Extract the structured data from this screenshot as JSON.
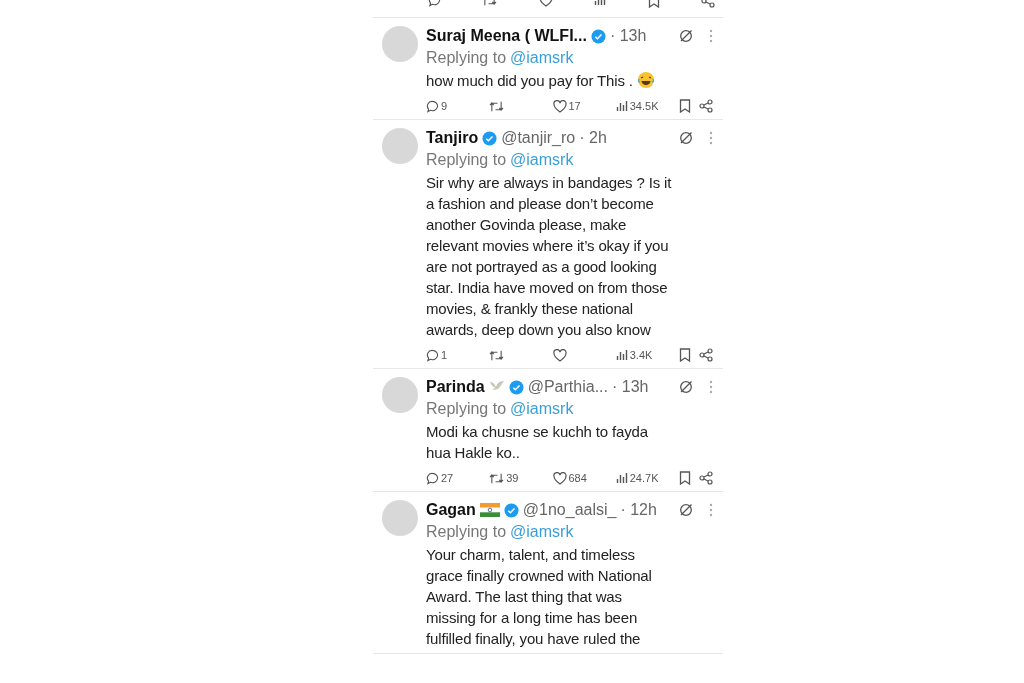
{
  "replies": [
    {
      "name": "Suraj Meena ( WLFI...",
      "verified": true,
      "time": "· 13h",
      "replying_label": "Replying to",
      "replying_to": "@iamsrk",
      "lines": [
        "how much did you pay for This ."
      ],
      "trailing_icon": {
        "kind": "laughing"
      },
      "stats": {
        "replies": "9",
        "likes": "17",
        "views": "34.5K"
      }
    },
    {
      "name": "Tanjiro",
      "verified": true,
      "handle": "@tanjir_ro",
      "time": "· 2h",
      "replying_label": "Replying to",
      "replying_to": "@iamsrk",
      "lines": [
        "Sir why are always in bandages ? Is it",
        "a fashion and please don’t become",
        "another Govinda please, make",
        "relevant movies where it’s okay if you",
        "are not portrayed as a good looking",
        "star. India have moved on from those",
        "movies, & frankly these national",
        "awards, deep down you also know"
      ],
      "stats": {
        "replies": "1",
        "views": "3.4K"
      }
    },
    {
      "name": "Parinda",
      "name_icon": {
        "kind": "dove"
      },
      "verified": true,
      "handle": "@Parthia...",
      "time": "· 13h",
      "replying_label": "Replying to",
      "replying_to": "@iamsrk",
      "lines": [
        "Modi ka chusne se kuchh to fayda",
        "hua Hakle ko.."
      ],
      "stats": {
        "replies": "27",
        "retweets": "39",
        "likes": "684",
        "views": "24.7K"
      }
    },
    {
      "name": "Gagan",
      "name_icon": {
        "kind": "flag"
      },
      "verified": true,
      "handle": "@1no_aalsi_",
      "time": "· 12h",
      "replying_label": "Replying to",
      "replying_to": "@iamsrk",
      "lines": [
        "Your charm, talent, and timeless",
        "grace finally crowned with National",
        "Award. The last thing that was",
        "missing for a long time has been",
        "fulfilled finally, you have ruled the"
      ]
    }
  ]
}
